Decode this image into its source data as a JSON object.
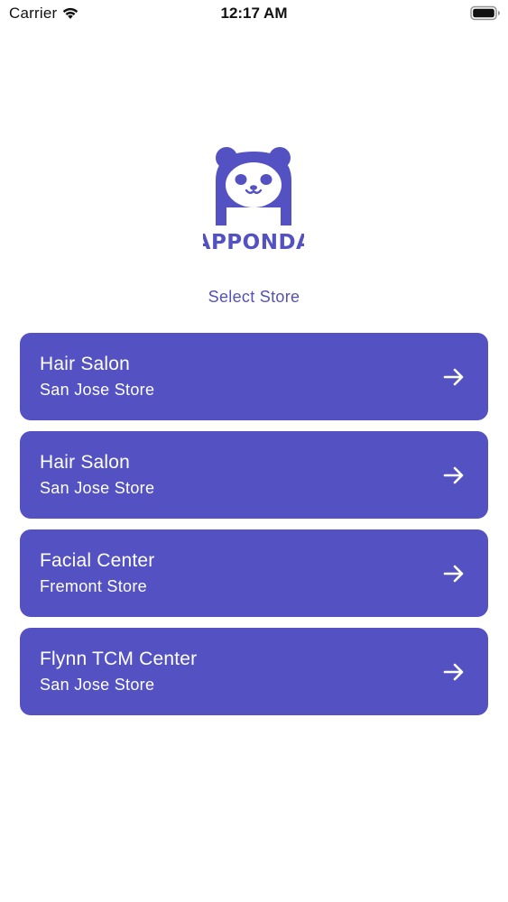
{
  "status_bar": {
    "carrier": "Carrier",
    "time": "12:17 AM",
    "wifi_icon": "wifi-icon",
    "battery_icon": "battery-icon"
  },
  "logo": {
    "text": "APPONDA",
    "color": "#5452c3"
  },
  "page": {
    "heading": "Select Store"
  },
  "stores": [
    {
      "name": "Hair Salon",
      "location": "San Jose Store",
      "icon": "arrow-right-icon"
    },
    {
      "name": "Hair Salon",
      "location": "San Jose Store",
      "icon": "arrow-right-icon"
    },
    {
      "name": "Facial Center",
      "location": "Fremont Store",
      "icon": "arrow-right-icon"
    },
    {
      "name": "Flynn TCM Center",
      "location": "San Jose Store",
      "icon": "arrow-right-icon"
    }
  ],
  "colors": {
    "accent": "#5452c3",
    "heading": "#5452b4",
    "card_text": "#ffffff"
  }
}
